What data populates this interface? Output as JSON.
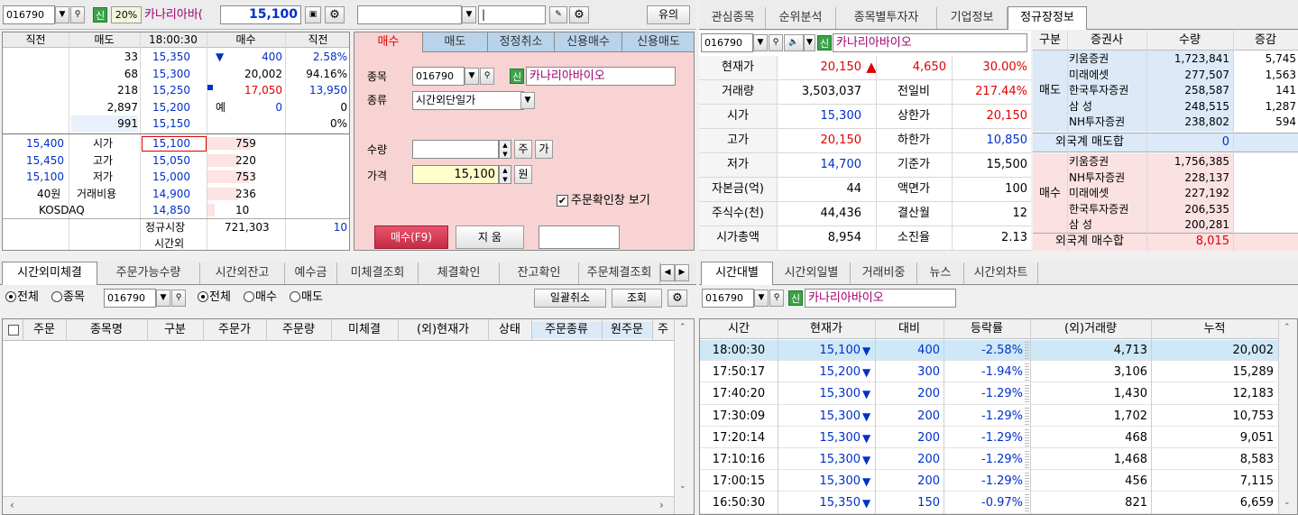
{
  "topbar": {
    "code": "016790",
    "shin": "신",
    "rate": "20%",
    "name": "카나리아바(",
    "price": "15,100",
    "center_input": "",
    "cursor_input": "|",
    "alert_btn": "유의"
  },
  "quote": {
    "headers": [
      "직전",
      "매도",
      "18:00:30",
      "매수",
      "직전"
    ],
    "ask_rows": [
      {
        "amt": "33",
        "price": "15,350"
      },
      {
        "amt": "68",
        "price": "15,300"
      },
      {
        "amt": "218",
        "price": "15,250"
      },
      {
        "amt": "2,897",
        "price": "15,200"
      },
      {
        "amt": "991",
        "price": "15,150"
      }
    ],
    "upper_right": [
      {
        "col1": "▼",
        "col2": "400",
        "col3": "2.58%"
      },
      {
        "col1": "",
        "col2": "20,002",
        "col3": "94.16%"
      },
      {
        "col1": "",
        "col2": "17,050",
        "col3": "13,950"
      },
      {
        "col1": "예",
        "col2": "0",
        "col3": "0"
      },
      {
        "col1": "",
        "col2": "",
        "col3": "0%"
      }
    ],
    "left_info": [
      {
        "v": "15,400",
        "k": "시가"
      },
      {
        "v": "15,450",
        "k": "고가"
      },
      {
        "v": "15,100",
        "k": "저가"
      },
      {
        "v": "40원",
        "k": "거래비용"
      },
      {
        "v": "KOSDAQ",
        "k": ""
      }
    ],
    "bid_rows": [
      {
        "price": "15,100",
        "amt": "759"
      },
      {
        "price": "15,050",
        "amt": "220"
      },
      {
        "price": "15,000",
        "amt": "753"
      },
      {
        "price": "14,900",
        "amt": "236"
      },
      {
        "price": "14,850",
        "amt": "10"
      }
    ],
    "regular_label": "정규시장",
    "regular_val": "721,303",
    "regular_right": "10",
    "after_label": "시간외"
  },
  "order": {
    "tabs": [
      "매수",
      "매도",
      "정정취소",
      "신용매수",
      "신용매도"
    ],
    "label_item": "종목",
    "code": "016790",
    "name": "카나리아바이오",
    "label_kind": "종류",
    "kind": "시간외단일가",
    "label_qty": "수량",
    "qty": "",
    "btn_ju": "주",
    "btn_ga": "가",
    "label_price": "가격",
    "price": "15,100",
    "btn_won": "원",
    "confirm": "주문확인창 보기",
    "buy_btn": "매수(F9)",
    "clear_btn": "지  움"
  },
  "right_tabs": [
    "관심종목",
    "순위분석",
    "종목별투자자",
    "기업정보",
    "정규장정보"
  ],
  "info": {
    "code": "016790",
    "name": "카나리아바이오",
    "rows": [
      {
        "k1": "현재가",
        "v1": "20,150",
        "mid": "▲",
        "v2": "4,650",
        "v3": "30.00%"
      },
      {
        "k1": "거래량",
        "v1": "3,503,037",
        "k2": "전일비",
        "v3": "217.44%"
      },
      {
        "k1": "시가",
        "v1": "15,300",
        "k2": "상한가",
        "v3": "20,150"
      },
      {
        "k1": "고가",
        "v1": "20,150",
        "k2": "하한가",
        "v3": "10,850"
      },
      {
        "k1": "저가",
        "v1": "14,700",
        "k2": "기준가",
        "v3": "15,500"
      },
      {
        "k1": "자본금(억)",
        "v1": "44",
        "k2": "액면가",
        "v3": "100"
      },
      {
        "k1": "주식수(천)",
        "v1": "44,436",
        "k2": "결산월",
        "v3": "12"
      },
      {
        "k1": "시가총액",
        "v1": "8,954",
        "k2": "소진율",
        "v3": "2.13"
      }
    ]
  },
  "broker": {
    "headers": [
      "구분",
      "증권사",
      "수량",
      "증감"
    ],
    "sell_label": "매도",
    "sell": [
      {
        "name": "키움증권",
        "qty": "1,723,841",
        "chg": "5,745"
      },
      {
        "name": "미래에셋",
        "qty": "277,507",
        "chg": "1,563"
      },
      {
        "name": "한국투자증권",
        "qty": "258,587",
        "chg": "141"
      },
      {
        "name": "삼  성",
        "qty": "248,515",
        "chg": "1,287"
      },
      {
        "name": "NH투자증권",
        "qty": "238,802",
        "chg": "594"
      }
    ],
    "foreign_sell_label": "외국계 매도합",
    "foreign_sell": "0",
    "buy_label": "매수",
    "buy": [
      {
        "name": "키움증권",
        "qty": "1,756,385"
      },
      {
        "name": "NH투자증권",
        "qty": "228,137"
      },
      {
        "name": "미래에셋",
        "qty": "227,192"
      },
      {
        "name": "한국투자증권",
        "qty": "206,535"
      },
      {
        "name": "삼  성",
        "qty": "200,281"
      }
    ],
    "foreign_buy_label": "외국계 매수합",
    "foreign_buy": "8,015"
  },
  "bottom_left": {
    "tabs": [
      "시간외미체결",
      "주문가능수량",
      "시간외잔고",
      "예수금",
      "미체결조회",
      "체결확인",
      "잔고확인",
      "주문체결조회"
    ],
    "radio1": [
      "전체",
      "종목"
    ],
    "code": "016790",
    "radio2": [
      "전체",
      "매수",
      "매도"
    ],
    "btn_cancel_all": "일괄취소",
    "btn_query": "조회",
    "columns": [
      "주문",
      "종목명",
      "구분",
      "주문가",
      "주문량",
      "미체결",
      "(외)현재가",
      "상태",
      "주문종류",
      "원주문",
      "주"
    ]
  },
  "bottom_right": {
    "tabs": [
      "시간대별",
      "시간외일별",
      "거래비중",
      "뉴스",
      "시간외차트"
    ],
    "code": "016790",
    "name": "카나리아바이오",
    "columns": [
      "시간",
      "현재가",
      "대비",
      "등락률",
      "(외)거래량",
      "누적"
    ],
    "rows": [
      {
        "t": "18:00:30",
        "p": "15,100",
        "d": "400",
        "r": "-2.58%",
        "v": "4,713",
        "a": "20,002"
      },
      {
        "t": "17:50:17",
        "p": "15,200",
        "d": "300",
        "r": "-1.94%",
        "v": "3,106",
        "a": "15,289"
      },
      {
        "t": "17:40:20",
        "p": "15,300",
        "d": "200",
        "r": "-1.29%",
        "v": "1,430",
        "a": "12,183"
      },
      {
        "t": "17:30:09",
        "p": "15,300",
        "d": "200",
        "r": "-1.29%",
        "v": "1,702",
        "a": "10,753"
      },
      {
        "t": "17:20:14",
        "p": "15,300",
        "d": "200",
        "r": "-1.29%",
        "v": "468",
        "a": "9,051"
      },
      {
        "t": "17:10:16",
        "p": "15,300",
        "d": "200",
        "r": "-1.29%",
        "v": "1,468",
        "a": "8,583"
      },
      {
        "t": "17:00:15",
        "p": "15,300",
        "d": "200",
        "r": "-1.29%",
        "v": "456",
        "a": "7,115"
      },
      {
        "t": "16:50:30",
        "p": "15,350",
        "d": "150",
        "r": "-0.97%",
        "v": "821",
        "a": "6,659"
      }
    ]
  }
}
